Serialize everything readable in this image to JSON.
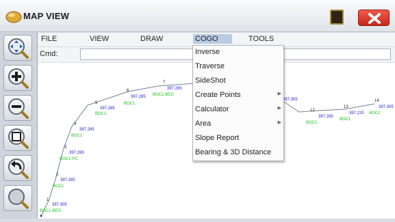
{
  "window": {
    "title": "MAP VIEW",
    "app_icon": "app-logo-icon",
    "card_icon": "sd-card-icon",
    "close_icon": "close-icon"
  },
  "menubar": {
    "items": [
      "FILE",
      "VIEW",
      "DRAW",
      "COGO",
      "TOOLS"
    ],
    "active": "COGO"
  },
  "command": {
    "label": "Cmd:",
    "value": ""
  },
  "toolbar": {
    "tools": [
      "pan-icon",
      "zoom-in-icon",
      "zoom-out-icon",
      "zoom-window-icon",
      "zoom-previous-icon",
      "zoom-extents-icon"
    ]
  },
  "cogo_menu": {
    "items": [
      {
        "label": "Inverse",
        "submenu": false
      },
      {
        "label": "Traverse",
        "submenu": false
      },
      {
        "label": "SideShot",
        "submenu": false
      },
      {
        "label": "Create Points",
        "submenu": true
      },
      {
        "label": "Calculator",
        "submenu": true
      },
      {
        "label": "Area",
        "submenu": true
      },
      {
        "label": "Slope Report",
        "submenu": false
      },
      {
        "label": "Bearing & 3D Distance",
        "submenu": false
      }
    ]
  },
  "map": {
    "points": [
      {
        "id": "1",
        "elev": "397.305",
        "code": "BOC1-BEG"
      },
      {
        "id": "2",
        "elev": "397.285",
        "code": "BOC1"
      },
      {
        "id": "3",
        "elev": "397.285",
        "code": "BOC1-PC"
      },
      {
        "id": "4",
        "elev": "397.285",
        "code": "BOC1"
      },
      {
        "id": "5",
        "elev": "397.285",
        "code": "BOC1"
      },
      {
        "id": "6",
        "elev": "397.285",
        "code": "BOC1"
      },
      {
        "id": "7",
        "elev": "397.285",
        "code": "BOC1-BEG"
      },
      {
        "id": "",
        "elev": "397.305",
        "code": ""
      },
      {
        "id": "12",
        "elev": "397.285",
        "code": "BOC1"
      },
      {
        "id": "13",
        "elev": "397.225",
        "code": "BOC1"
      },
      {
        "id": "14",
        "elev": "397.305",
        "code": "BOC1"
      }
    ],
    "colors": {
      "line": "#6f7f90",
      "elev": "#2020d0",
      "code": "#18c018",
      "point_id": "#222222"
    }
  }
}
